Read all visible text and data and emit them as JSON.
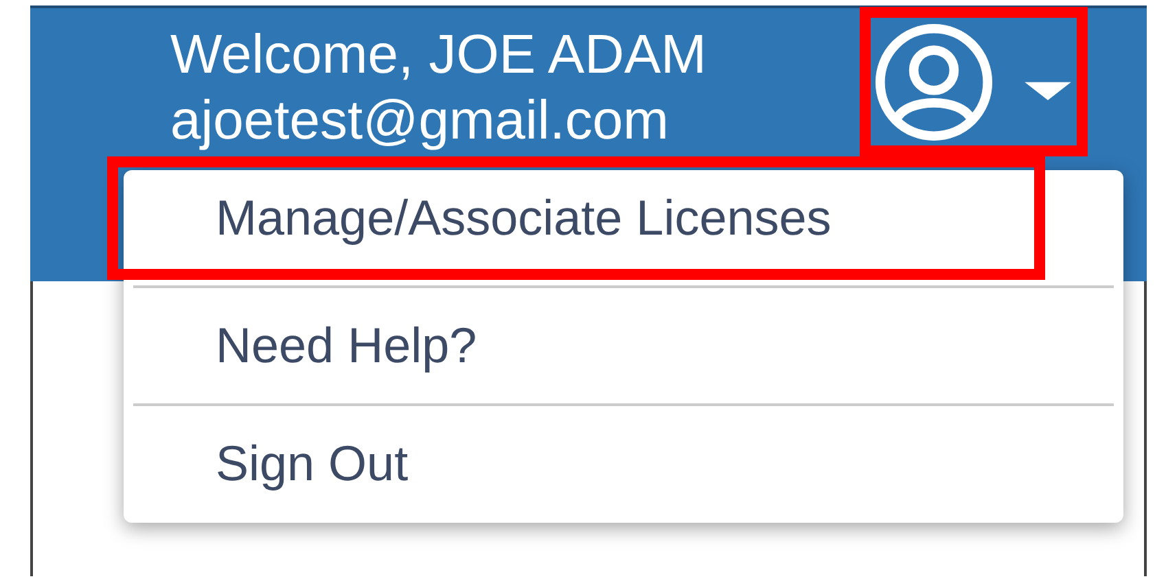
{
  "header": {
    "welcome": "Welcome, JOE ADAM",
    "email": "ajoetest@gmail.com"
  },
  "user_menu_button": {
    "expanded": true,
    "highlighted": true
  },
  "menu": {
    "items": [
      {
        "label": "Manage/Associate Licenses",
        "highlighted": true
      },
      {
        "label": "Need Help?",
        "highlighted": false
      },
      {
        "label": "Sign Out",
        "highlighted": false
      }
    ]
  }
}
